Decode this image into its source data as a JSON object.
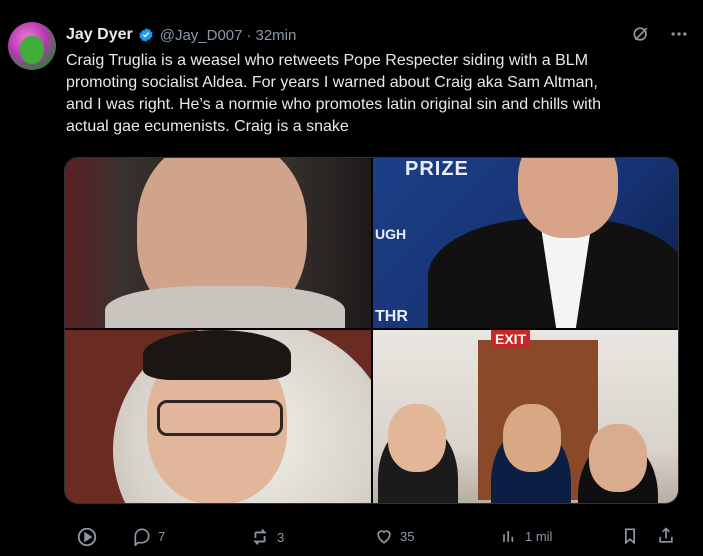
{
  "post": {
    "author": {
      "name": "Jay Dyer",
      "handle": "@Jay_D007",
      "time": "32min",
      "verified": true
    },
    "text": "Craig Truglia is a weasel who retweets Pope Respecter siding with a BLM\npromoting socialist Aldea.  For years I warned about Craig aka Sam Altman,\nand I was right. He’s a normie who promotes latin original sin and chills with\nactual gae ecumenists. Craig is a snake",
    "media": {
      "photo_texts": {
        "prize": "PRIZE",
        "ugh": "UGH",
        "thr": "THR",
        "exit": "EXIT"
      }
    },
    "actions": {
      "replies": "7",
      "reposts": "3",
      "likes": "35",
      "views": "1 mil"
    }
  },
  "icons": {
    "verified": "verified-badge-icon",
    "grok": "grok-icon",
    "more": "more-options-icon",
    "play": "play-icon",
    "reply": "reply-icon",
    "repost": "repost-icon",
    "like": "like-icon",
    "views": "views-icon",
    "bookmark": "bookmark-icon",
    "share": "share-icon"
  },
  "colors": {
    "background": "#000000",
    "text": "#e7e9ea",
    "muted": "#8b98a5",
    "verified": "#1d9bf0"
  }
}
